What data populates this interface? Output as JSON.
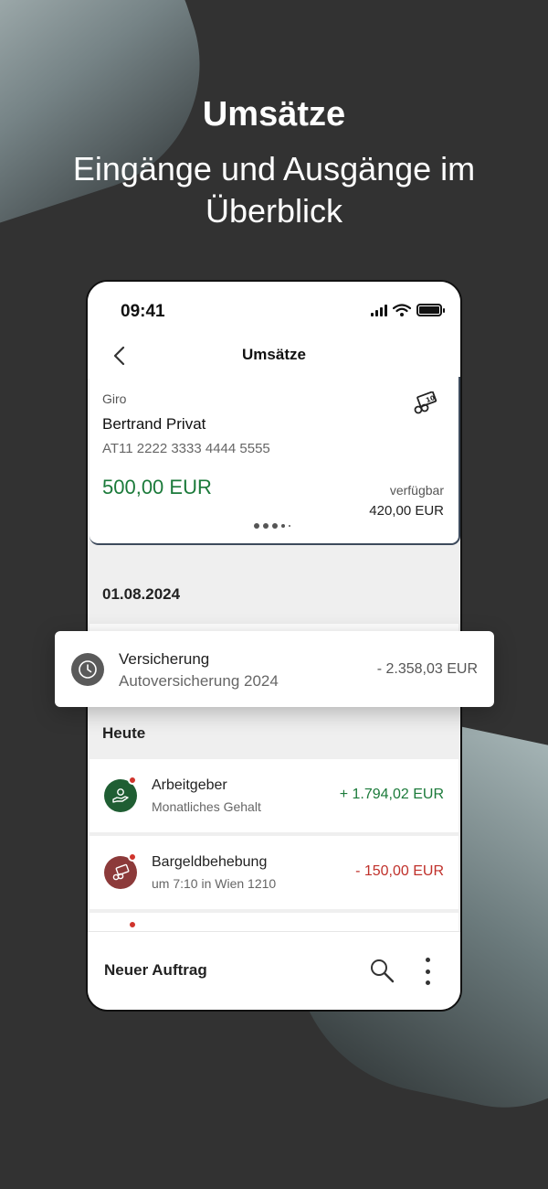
{
  "headline": "Umsätze",
  "subheadline": "Eingänge und Ausgänge im Überblick",
  "status_bar": {
    "time": "09:41"
  },
  "nav": {
    "title": "Umsätze"
  },
  "account": {
    "type": "Giro",
    "name": "Bertrand Privat",
    "iban": "AT11 2222 3333 4444 5555",
    "balance": "500,00 EUR",
    "available_label": "verfügbar",
    "available_value": "420,00 EUR"
  },
  "sections": {
    "date": "01.08.2024",
    "today": "Heute"
  },
  "highlighted_transaction": {
    "title": "Versicherung",
    "subtitle": "Autoversicherung 2024",
    "amount": "- 2.358,03 EUR",
    "icon": "clock-history-icon"
  },
  "transactions": [
    {
      "title": "Arbeitgeber",
      "subtitle": "Monatliches Gehalt",
      "amount": "+ 1.794,02 EUR",
      "color": "#1b7a3a",
      "icon": "salary-hand-icon"
    },
    {
      "title": "Bargeldbehebung",
      "subtitle": "um 7:10 in Wien 1210",
      "amount": "- 150,00 EUR",
      "color": "#c0312b",
      "icon": "cash-withdrawal-icon"
    }
  ],
  "bottom_bar": {
    "new_order": "Neuer Auftrag"
  },
  "colors": {
    "positive": "#1b7a3a",
    "negative": "#c0312b",
    "salary_circle": "#1f5e33",
    "cash_circle": "#8c3a3a"
  }
}
